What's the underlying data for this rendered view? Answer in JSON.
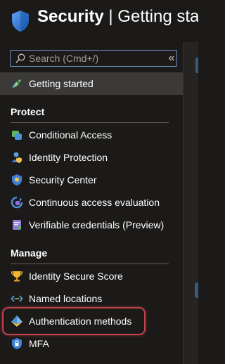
{
  "header": {
    "title_bold": "Security",
    "separator": " | ",
    "title_rest": "Getting star"
  },
  "search": {
    "placeholder": "Search (Cmd+/)",
    "value": "",
    "collapse_label": "«"
  },
  "nav": {
    "getting_started": {
      "label": "Getting started",
      "icon": "rocket-icon"
    },
    "sections": [
      {
        "title": "Protect",
        "items": [
          {
            "label": "Conditional Access",
            "icon": "conditional-access-icon"
          },
          {
            "label": "Identity Protection",
            "icon": "identity-protection-icon"
          },
          {
            "label": "Security Center",
            "icon": "security-center-icon"
          },
          {
            "label": "Continuous access evaluation",
            "icon": "continuous-access-icon"
          },
          {
            "label": "Verifiable credentials (Preview)",
            "icon": "verifiable-credentials-icon"
          }
        ]
      },
      {
        "title": "Manage",
        "items": [
          {
            "label": "Identity Secure Score",
            "icon": "trophy-icon"
          },
          {
            "label": "Named locations",
            "icon": "named-locations-icon"
          },
          {
            "label": "Authentication methods",
            "icon": "authentication-methods-icon"
          },
          {
            "label": "MFA",
            "icon": "mfa-shield-icon"
          }
        ]
      }
    ]
  },
  "colors": {
    "background": "#1b1a19",
    "selected": "#3b3a39",
    "highlight": "#c0424b",
    "search_border": "#6c8fbf"
  }
}
